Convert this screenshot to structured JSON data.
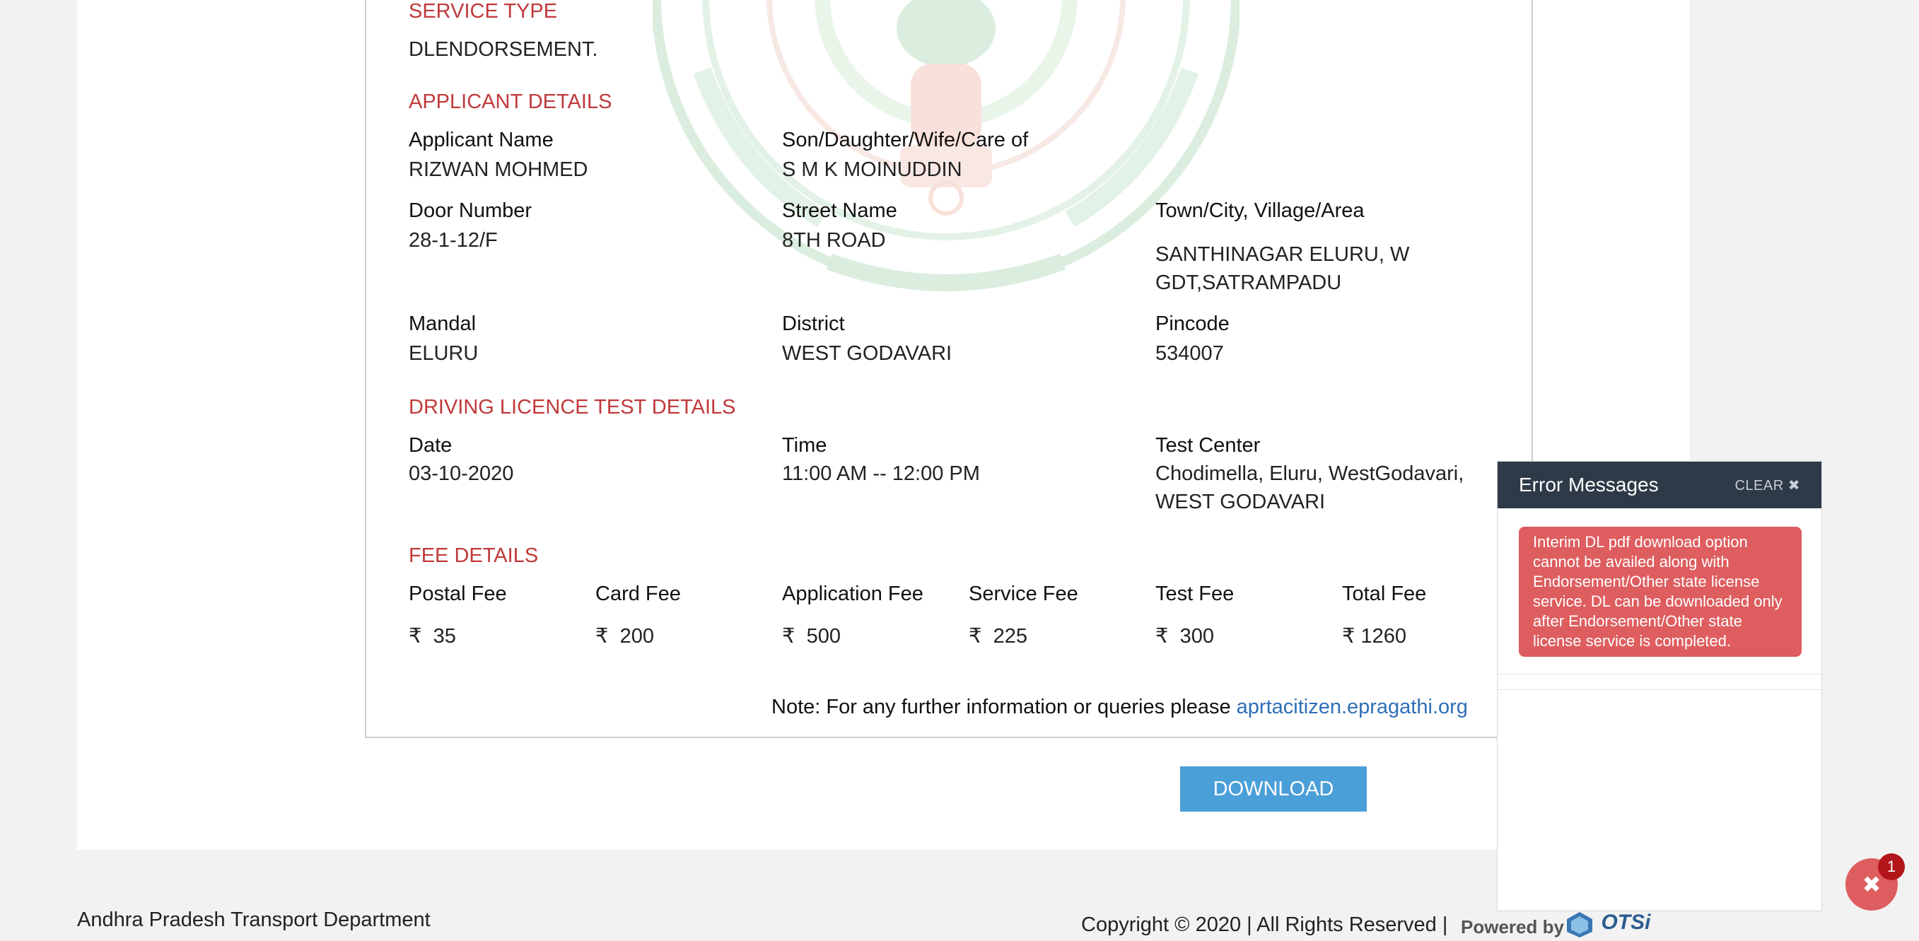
{
  "service": {
    "section_title": "SERVICE TYPE",
    "value": "DLENDORSEMENT."
  },
  "applicant": {
    "section_title": "APPLICANT DETAILS",
    "name_label": "Applicant Name",
    "name_value": "RIZWAN MOHMED",
    "relation_label": "Son/Daughter/Wife/Care of",
    "relation_value": "S M K MOINUDDIN",
    "door_label": "Door Number",
    "door_value": "28-1-12/F",
    "street_label": "Street Name",
    "street_value": "8TH ROAD",
    "town_label": "Town/City, Village/Area",
    "town_value_line1": "SANTHINAGAR ELURU, W",
    "town_value_line2": "GDT,SATRAMPADU",
    "mandal_label": "Mandal",
    "mandal_value": "ELURU",
    "district_label": "District",
    "district_value": "WEST GODAVARI",
    "pincode_label": "Pincode",
    "pincode_value": "534007"
  },
  "test": {
    "section_title": "DRIVING LICENCE TEST DETAILS",
    "date_label": "Date",
    "date_value": "03-10-2020",
    "time_label": "Time",
    "time_value": "11:00 AM -- 12:00 PM",
    "center_label": "Test Center",
    "center_value_line1": "Chodimella, Eluru, WestGodavari,",
    "center_value_line2": "WEST GODAVARI"
  },
  "fees": {
    "section_title": "FEE DETAILS",
    "currency_symbol": "₹",
    "items": [
      {
        "label": "Postal Fee",
        "value": "35"
      },
      {
        "label": "Card Fee",
        "value": "200"
      },
      {
        "label": "Application Fee",
        "value": "500"
      },
      {
        "label": "Service Fee",
        "value": "225"
      },
      {
        "label": "Test Fee",
        "value": "300"
      },
      {
        "label": "Total Fee",
        "value": "1260"
      }
    ]
  },
  "note": {
    "text": "Note: For any further information or queries please ",
    "link": "aprtacitizen.epragathi.org"
  },
  "actions": {
    "download_label": "DOWNLOAD"
  },
  "footer": {
    "left": "Andhra Pradesh Transport Department",
    "right": "Copyright © 2020 | All Rights Reserved |",
    "powered_by": "Powered by",
    "logo_text": "OTSi"
  },
  "error_panel": {
    "title": "Error Messages",
    "clear_label": "CLEAR ✖",
    "message": "Interim DL pdf download option cannot be availed along with Endorsement/Other state license service. DL can be downloaded only after Endorsement/Other state license service is completed."
  },
  "fab": {
    "icon": "✖",
    "badge": "1"
  },
  "colors": {
    "accent_red": "#c0393b",
    "button_blue": "#4a9fd8",
    "error_red": "#de5d5f",
    "panel_dark": "#2e3a48",
    "link_blue": "#2f6fb5"
  }
}
